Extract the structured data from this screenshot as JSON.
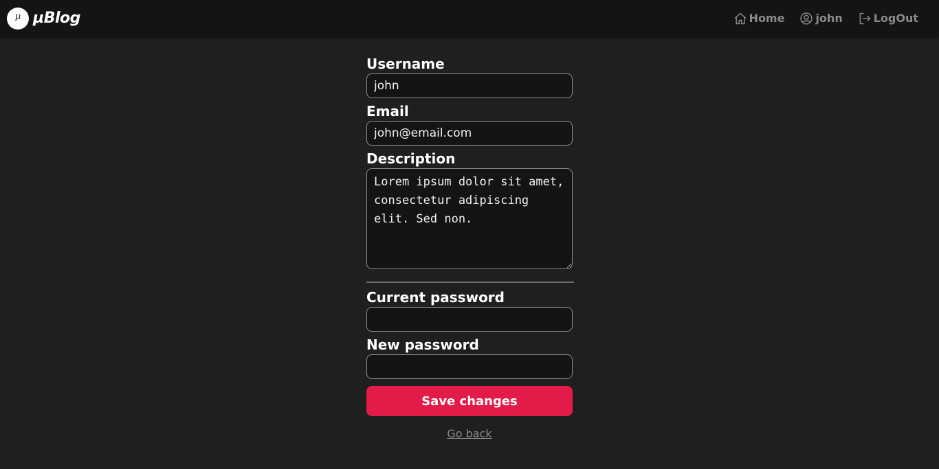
{
  "brand": {
    "logo_glyph": "µ",
    "name": "µBlog"
  },
  "nav": {
    "home": {
      "label": "Home",
      "icon": "home-icon"
    },
    "profile": {
      "label": "john",
      "icon": "user-circle-icon"
    },
    "logout": {
      "label": "LogOut",
      "icon": "logout-icon"
    }
  },
  "form": {
    "username": {
      "label": "Username",
      "value": "john"
    },
    "email": {
      "label": "Email",
      "value": "john@email.com"
    },
    "description": {
      "label": "Description",
      "value": "Lorem ipsum dolor sit amet, consectetur adipiscing elit. Sed non."
    },
    "current_password": {
      "label": "Current password",
      "value": ""
    },
    "new_password": {
      "label": "New password",
      "value": ""
    },
    "save_label": "Save changes",
    "back_label": "Go back"
  },
  "colors": {
    "background": "#1f1f1f",
    "navbar": "#141414",
    "accent": "#e31b48",
    "muted_text": "#8a8a8a"
  }
}
